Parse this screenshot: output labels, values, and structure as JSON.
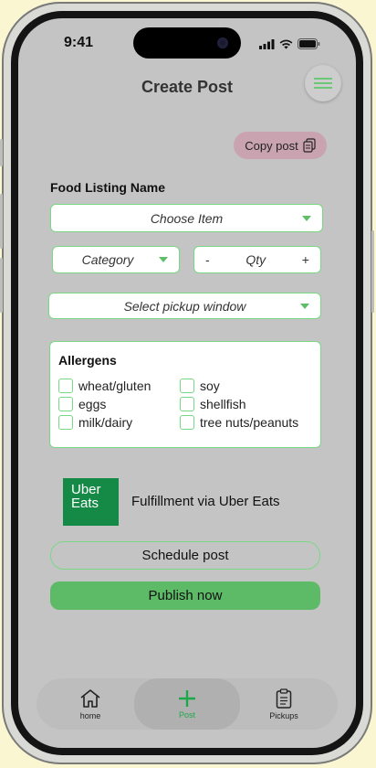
{
  "status": {
    "time": "9:41"
  },
  "header": {
    "title": "Create Post",
    "menu_icon": "hamburger-icon"
  },
  "copy_post": {
    "label": "Copy post",
    "icon": "clipboard-copy-icon"
  },
  "form": {
    "food_listing_label": "Food Listing Name",
    "item_select": "Choose Item",
    "category_select": "Category",
    "qty": {
      "minus": "-",
      "label": "Qty",
      "plus": "+"
    },
    "pickup_select": "Select pickup window"
  },
  "allergens": {
    "title": "Allergens",
    "items": [
      "wheat/gluten",
      "soy",
      "eggs",
      "shellfish",
      "milk/dairy",
      "tree nuts/peanuts"
    ]
  },
  "fulfillment": {
    "logo_line1": "Uber",
    "logo_line2": "Eats",
    "text": "Fulfillment via Uber Eats"
  },
  "actions": {
    "schedule": "Schedule post",
    "publish": "Publish now"
  },
  "tabs": [
    {
      "label": "home",
      "icon": "home-icon"
    },
    {
      "label": "Post",
      "icon": "plus-icon"
    },
    {
      "label": "Pickups",
      "icon": "clipboard-icon"
    }
  ],
  "colors": {
    "accent": "#5dbb67",
    "brand_green": "#158a46",
    "copy_pill": "#c9a4b0",
    "active_tab": "#1da94a"
  }
}
